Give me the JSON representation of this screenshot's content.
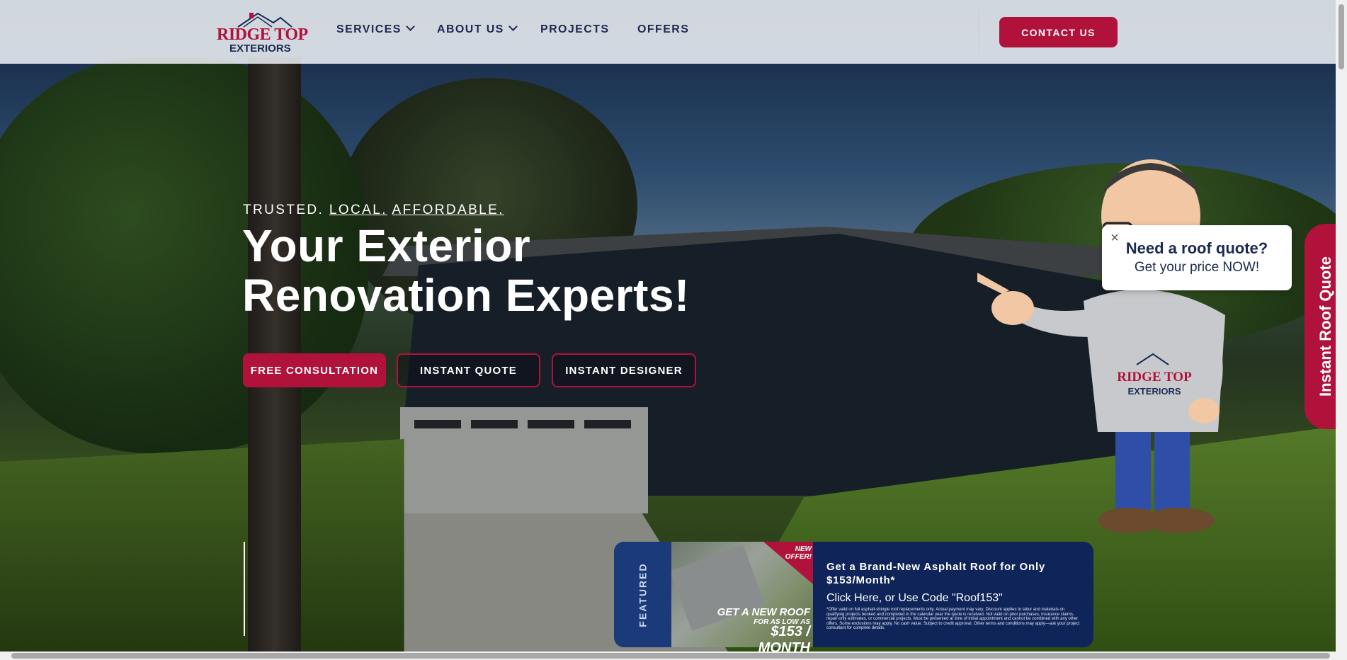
{
  "header": {
    "logo_name": "RIDGE TOP",
    "logo_sub": "EXTERIORS",
    "nav": [
      {
        "label": "SERVICES",
        "has_dropdown": true
      },
      {
        "label": "ABOUT US",
        "has_dropdown": true
      },
      {
        "label": "PROJECTS",
        "has_dropdown": false
      },
      {
        "label": "OFFERS",
        "has_dropdown": false
      }
    ],
    "contact_label": "CONTACT US"
  },
  "hero": {
    "tagline": {
      "w1": "TRUSTED.",
      "w2": "LOCAL.",
      "w3": "AFFORDABLE."
    },
    "headline_line1": "Your Exterior",
    "headline_line2": "Renovation Experts!",
    "buttons": {
      "consultation": "FREE CONSULTATION",
      "quote": "INSTANT QUOTE",
      "designer": "INSTANT DESIGNER"
    }
  },
  "quote_widget": {
    "side_tab": "Instant Roof Quote",
    "bubble_title": "Need a roof quote?",
    "bubble_sub": "Get your price NOW!",
    "close": "×",
    "mascot_shirt_name": "RIDGE TOP",
    "mascot_shirt_sub": "EXTERIORS"
  },
  "promo": {
    "featured": "FEATURED",
    "new_badge": "NEW OFFER!",
    "img_line1": "GET A NEW ROOF",
    "img_line2": "FOR AS LOW AS",
    "img_line3": "$153 / MONTH",
    "title": "Get a Brand-New Asphalt Roof for Only $153/Month*",
    "link": "Click Here, or Use Code \"Roof153\"",
    "fine_print": "*Offer valid on full asphalt-shingle roof replacements only. Actual payment may vary. Discount applies to labor and materials on qualifying projects booked and completed in the calendar year the quote is received. Not valid on prior purchases, insurance claims, repair-only estimates, or commercial projects. Must be presented at time of initial appointment and cannot be combined with any other offers. Some exclusions may apply. No cash value. Subject to credit approval. Other terms and conditions may apply—ask your project consultant for complete details."
  },
  "colors": {
    "brand_red": "#b0123b",
    "brand_navy": "#1b2a52",
    "promo_navy": "#0f2559"
  }
}
